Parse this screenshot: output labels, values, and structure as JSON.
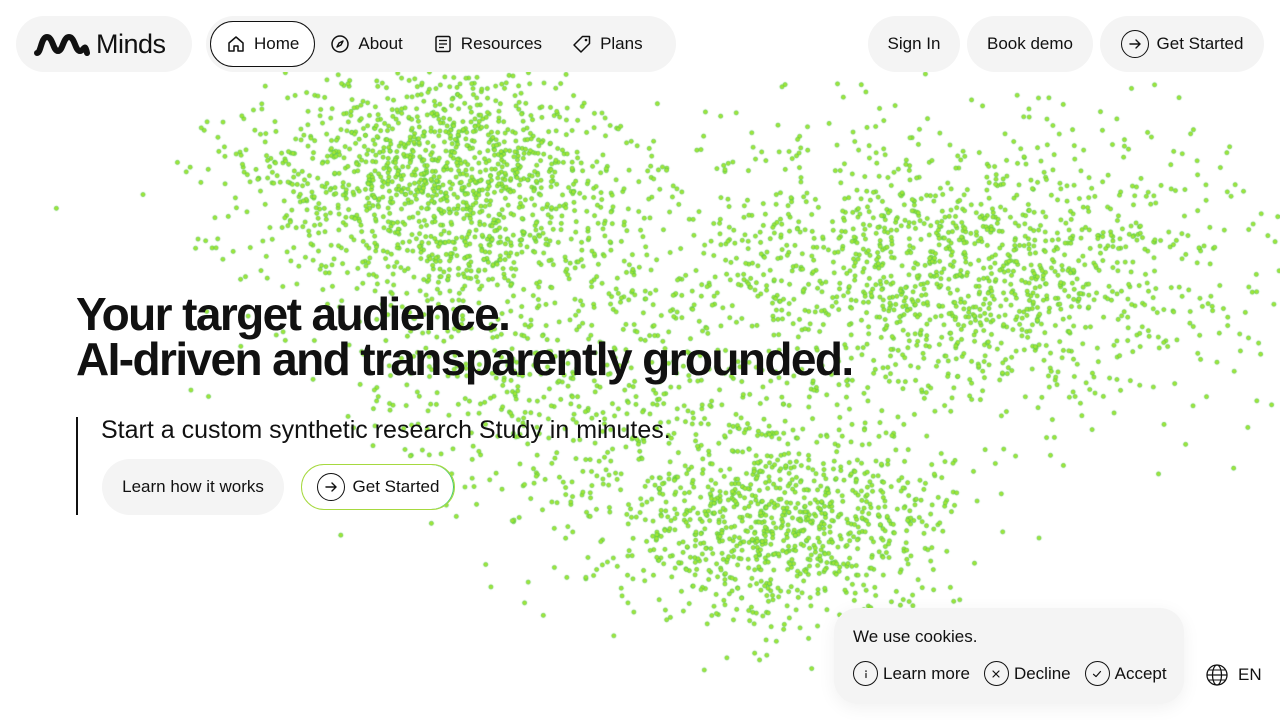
{
  "brand": {
    "name": "Minds"
  },
  "nav": {
    "items": [
      {
        "label": "Home",
        "icon": "home-icon",
        "active": true
      },
      {
        "label": "About",
        "icon": "compass-icon",
        "active": false
      },
      {
        "label": "Resources",
        "icon": "document-icon",
        "active": false
      },
      {
        "label": "Plans",
        "icon": "tag-icon",
        "active": false
      }
    ]
  },
  "header_actions": {
    "sign_in": "Sign In",
    "book_demo": "Book demo",
    "get_started": "Get Started"
  },
  "hero": {
    "title_line1": "Your target audience.",
    "title_line2": "AI-driven and transparently grounded.",
    "subtitle": "Start a custom synthetic research Study in minutes.",
    "learn_button": "Learn how it works",
    "get_started_button": "Get Started"
  },
  "cookie_banner": {
    "text": "We use cookies.",
    "learn_more": "Learn more",
    "decline": "Decline",
    "accept": "Accept"
  },
  "language": {
    "label": "EN"
  },
  "colors": {
    "particle_fill": "#a3e635",
    "particle_stroke": "#4cc24a",
    "pill_background": "#f4f4f4",
    "text": "#111111"
  }
}
